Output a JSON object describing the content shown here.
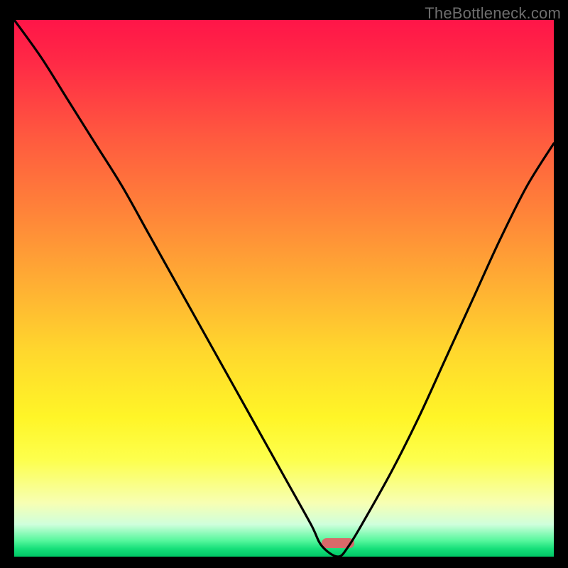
{
  "watermark": "TheBottleneck.com",
  "colors": {
    "background": "#000000",
    "curve": "#000000",
    "pill": "#d86a6a"
  },
  "chart_data": {
    "type": "line",
    "title": "",
    "xlabel": "",
    "ylabel": "",
    "x_range": [
      0,
      100
    ],
    "y_range": [
      0,
      100
    ],
    "series": [
      {
        "name": "bottleneck-curve",
        "x": [
          0,
          5,
          10,
          15,
          20,
          25,
          30,
          35,
          40,
          45,
          50,
          55,
          57,
          60,
          62,
          65,
          70,
          75,
          80,
          85,
          90,
          95,
          100
        ],
        "y": [
          100,
          93,
          85,
          77,
          69,
          60,
          51,
          42,
          33,
          24,
          15,
          6,
          2,
          0,
          2,
          7,
          16,
          26,
          37,
          48,
          59,
          69,
          77
        ]
      }
    ],
    "optimal_marker": {
      "x": 60,
      "width_pct": 6
    },
    "gradient_stops": [
      {
        "pct": 0,
        "color": "#ff1548"
      },
      {
        "pct": 8,
        "color": "#ff2a46"
      },
      {
        "pct": 22,
        "color": "#ff5a3f"
      },
      {
        "pct": 36,
        "color": "#ff8439"
      },
      {
        "pct": 50,
        "color": "#ffb133"
      },
      {
        "pct": 62,
        "color": "#ffd82d"
      },
      {
        "pct": 74,
        "color": "#fff527"
      },
      {
        "pct": 82,
        "color": "#fdff4d"
      },
      {
        "pct": 90,
        "color": "#f7ffb3"
      },
      {
        "pct": 94,
        "color": "#cfffdc"
      },
      {
        "pct": 97,
        "color": "#57f79d"
      },
      {
        "pct": 98.5,
        "color": "#17e07a"
      },
      {
        "pct": 100,
        "color": "#00c765"
      }
    ]
  }
}
